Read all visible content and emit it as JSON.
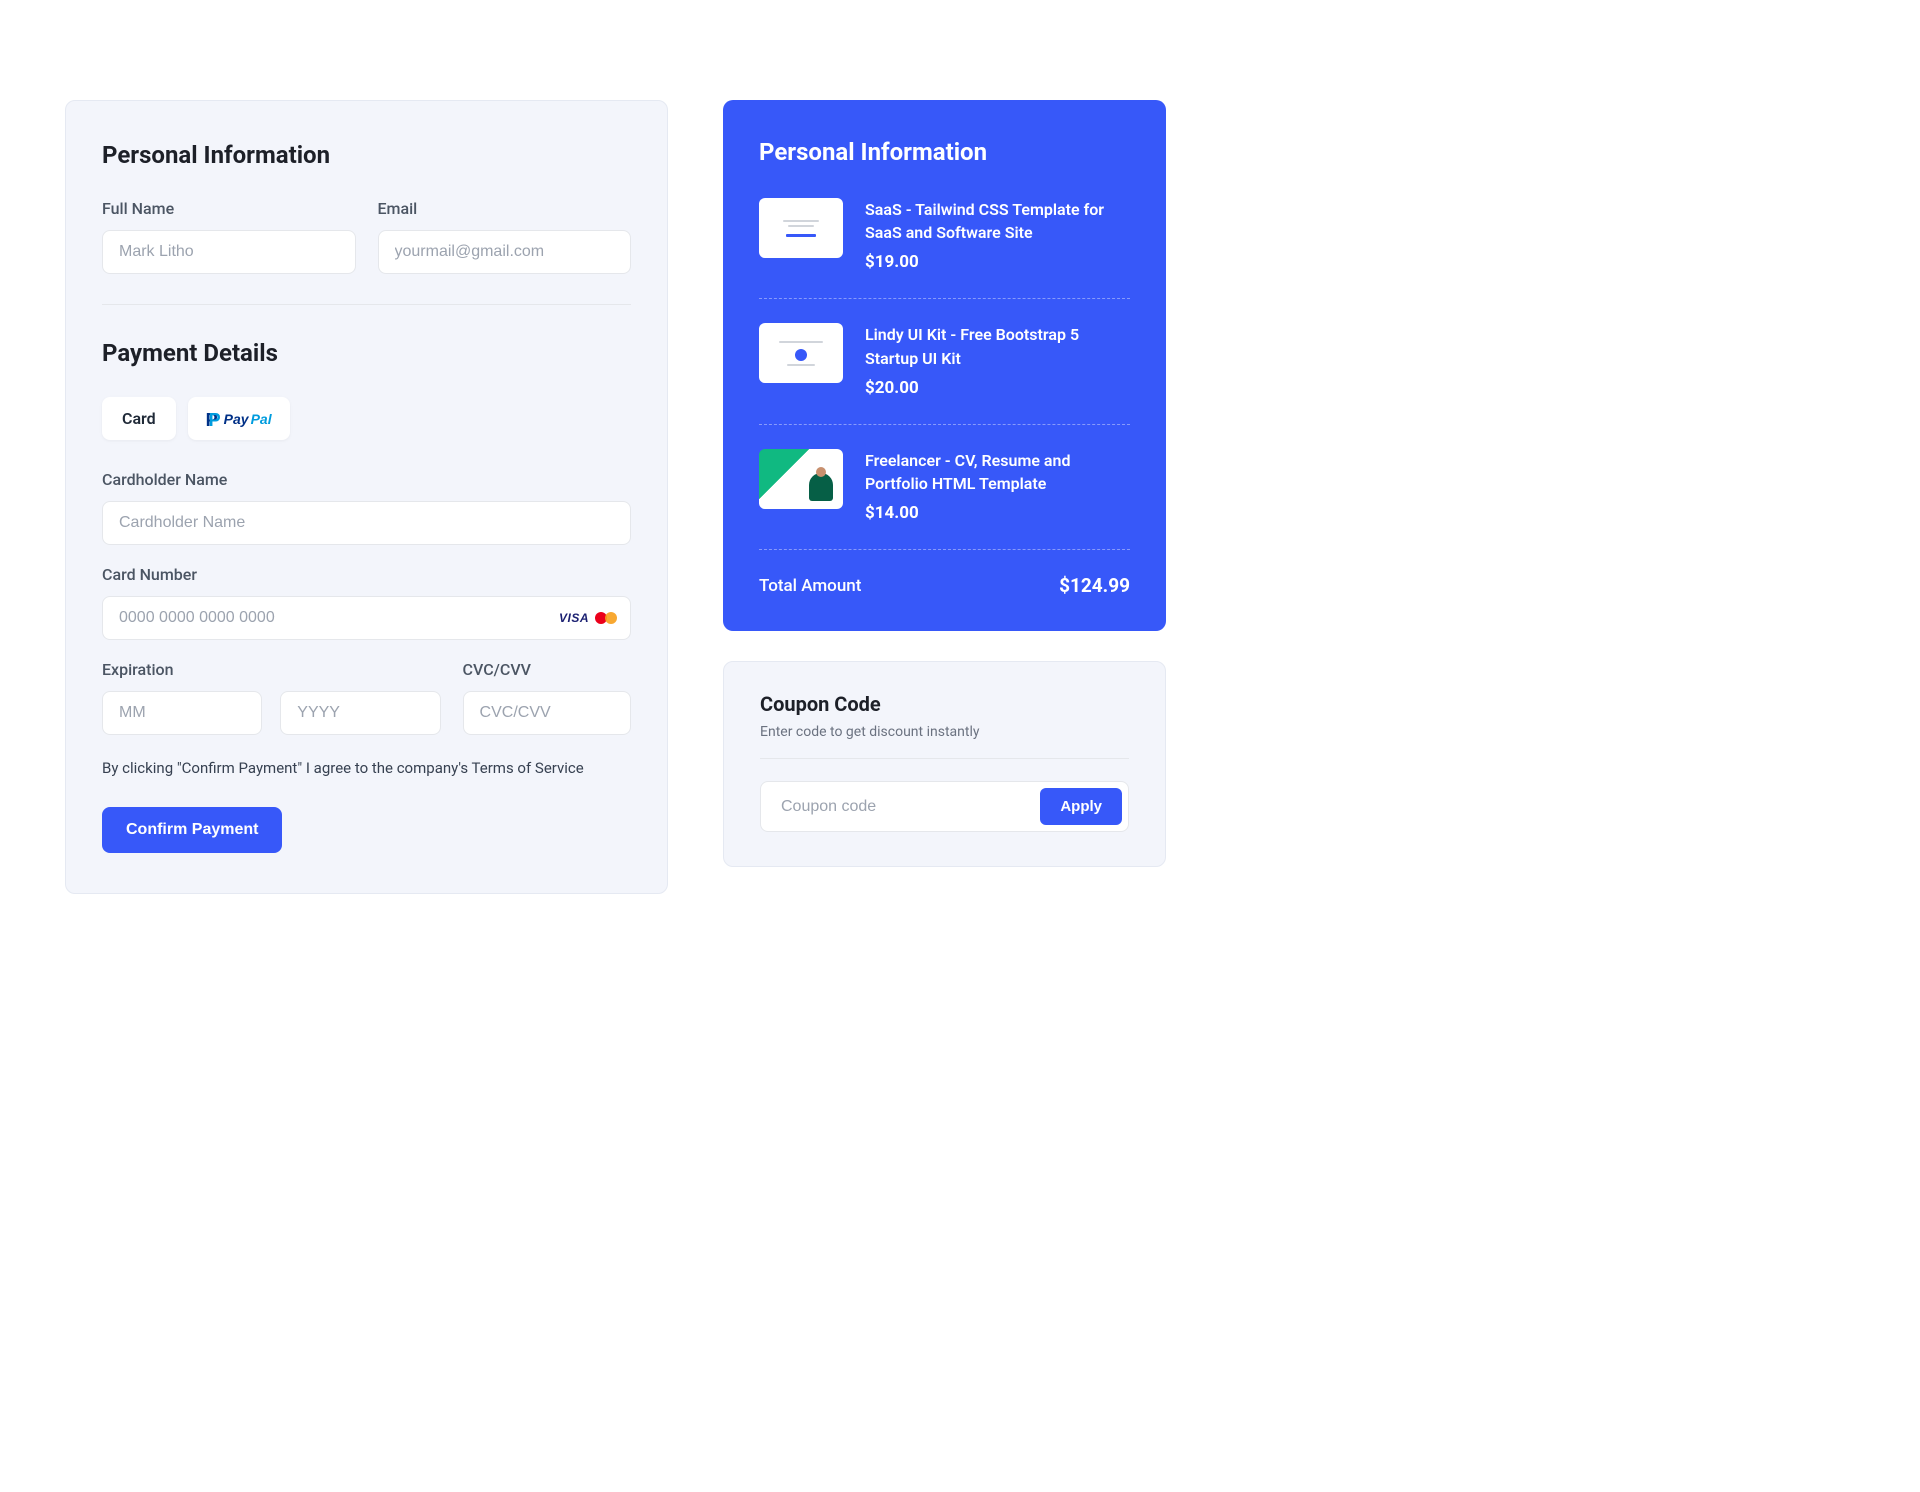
{
  "personal": {
    "title": "Personal Information",
    "fullname_label": "Full Name",
    "fullname_placeholder": "Mark Litho",
    "email_label": "Email",
    "email_placeholder": "yourmail@gmail.com"
  },
  "payment": {
    "title": "Payment Details",
    "tab_card": "Card",
    "cardholder_label": "Cardholder Name",
    "cardholder_placeholder": "Cardholder Name",
    "cardnumber_label": "Card Number",
    "cardnumber_placeholder": "0000 0000 0000 0000",
    "expiration_label": "Expiration",
    "mm_placeholder": "MM",
    "yyyy_placeholder": "YYYY",
    "cvc_label": "CVC/CVV",
    "cvc_placeholder": "CVC/CVV",
    "agree_text": "By clicking \"Confirm Payment\" I agree to the company's Terms of Service",
    "confirm_button": "Confirm Payment"
  },
  "paypal": {
    "pay": "Pay",
    "pal": "Pal"
  },
  "summary": {
    "title": "Personal Information",
    "items": [
      {
        "title": "SaaS - Tailwind CSS Template for SaaS and Software Site",
        "price": "$19.00"
      },
      {
        "title": "Lindy UI Kit - Free Bootstrap 5 Startup UI Kit",
        "price": "$20.00"
      },
      {
        "title": "Freelancer - CV, Resume and Portfolio HTML Template",
        "price": "$14.00"
      }
    ],
    "total_label": "Total Amount",
    "total_amount": "$124.99"
  },
  "coupon": {
    "title": "Coupon Code",
    "subtitle": "Enter code to get discount instantly",
    "placeholder": "Coupon code",
    "apply": "Apply"
  }
}
